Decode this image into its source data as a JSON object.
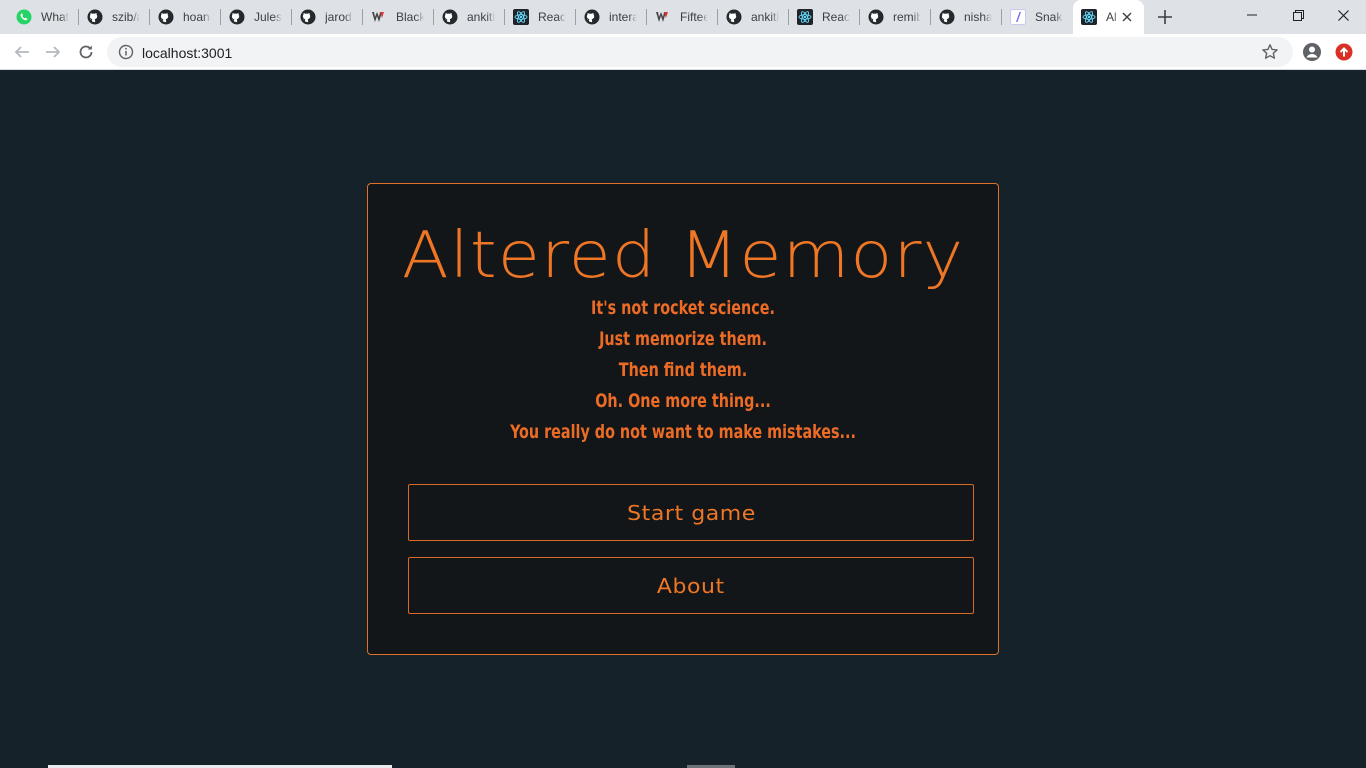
{
  "browser": {
    "tabs": [
      {
        "title": "WhatsApp",
        "icon": "whatsapp-icon"
      },
      {
        "title": "szib/a",
        "icon": "github-icon"
      },
      {
        "title": "hoang",
        "icon": "github-icon"
      },
      {
        "title": "JulesB",
        "icon": "github-icon"
      },
      {
        "title": "jarodt",
        "icon": "github-icon"
      },
      {
        "title": "Blackj",
        "icon": "vu-icon"
      },
      {
        "title": "ankitk",
        "icon": "github-icon"
      },
      {
        "title": "React",
        "icon": "react-icon"
      },
      {
        "title": "intera",
        "icon": "github-icon"
      },
      {
        "title": "Fiftee",
        "icon": "vu-icon"
      },
      {
        "title": "ankitk",
        "icon": "github-icon"
      },
      {
        "title": "React",
        "icon": "react-icon"
      },
      {
        "title": "remib",
        "icon": "github-icon"
      },
      {
        "title": "nishal",
        "icon": "github-icon"
      },
      {
        "title": "Snake",
        "icon": "snake-icon"
      },
      {
        "title": "Al",
        "icon": "react-icon",
        "active": true
      }
    ],
    "address": "localhost:3001"
  },
  "page": {
    "title": "Altered Memory",
    "tagline": [
      "It's not rocket science.",
      "Just memorize them.",
      "Then find them.",
      "Oh. One more thing...",
      "You really do not want to make mistakes..."
    ],
    "buttons": {
      "start": "Start game",
      "about": "About"
    }
  },
  "colors": {
    "background": "#15222a",
    "card": "#121619",
    "accent": "#ef7625"
  }
}
